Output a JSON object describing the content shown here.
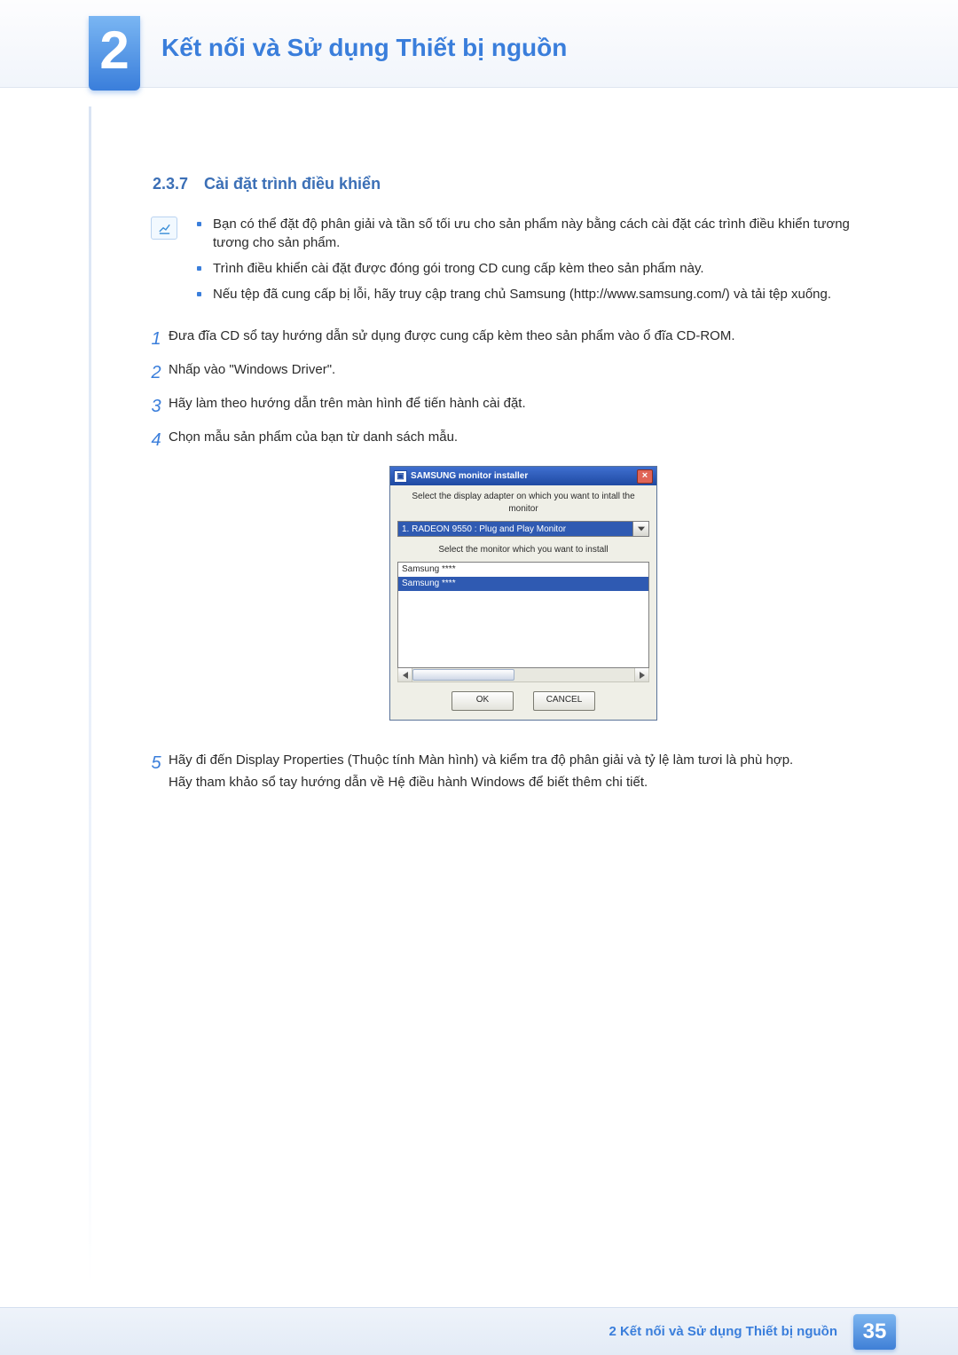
{
  "header": {
    "chapter_num": "2",
    "chapter_title": "Kết nối và Sử dụng Thiết bị nguồn"
  },
  "section": {
    "number": "2.3.7",
    "title": "Cài đặt trình điều khiển"
  },
  "info_bullets": [
    "Bạn có thể đặt độ phân giải và tần số tối ưu cho sản phẩm này bằng cách cài đặt các trình điều khiển tương tương cho sản phẩm.",
    "Trình điều khiển cài đặt được đóng gói trong CD cung cấp kèm theo sản phẩm này.",
    "Nếu tệp đã cung cấp bị lỗi, hãy truy cập trang chủ Samsung (http://www.samsung.com/) và tải tệp xuống."
  ],
  "steps": {
    "s1": "Đưa đĩa CD sổ tay hướng dẫn sử dụng được cung cấp kèm theo sản phẩm vào ổ đĩa CD-ROM.",
    "s2": "Nhấp vào \"Windows Driver\".",
    "s3": "Hãy làm theo hướng dẫn trên màn hình để tiến hành cài đặt.",
    "s4": "Chọn mẫu sản phẩm của bạn từ danh sách mẫu.",
    "s5_a": "Hãy đi đến Display Properties (Thuộc tính Màn hình) và kiểm tra độ phân giải và tỷ lệ làm tươi là phù hợp.",
    "s5_b": "Hãy tham khảo sổ tay hướng dẫn về Hệ điều hành Windows để biết thêm chi tiết."
  },
  "dialog": {
    "title": "SAMSUNG monitor installer",
    "label_adapter": "Select the display adapter on which you want to intall the monitor",
    "adapter_value": "1. RADEON 9550 : Plug and Play Monitor",
    "label_monitor": "Select the monitor which you want to install",
    "list_item1": "Samsung ****",
    "list_item2": "Samsung ****",
    "ok": "OK",
    "cancel": "CANCEL"
  },
  "footer": {
    "chapter_label": "2 Kết nối và Sử dụng Thiết bị nguồn",
    "page": "35"
  }
}
